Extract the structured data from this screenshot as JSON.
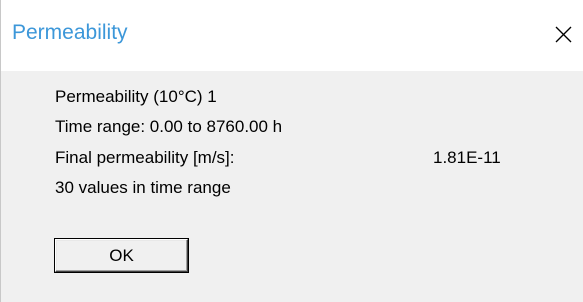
{
  "window": {
    "title": "Permeability",
    "close_icon": "close-icon"
  },
  "info": {
    "line1": "Permeability (10°C) 1",
    "line2": "Time range: 0.00 to 8760.00 h",
    "final_label": "Final permeability [m/s]:",
    "final_value": "1.81E-11",
    "line4": "30 values in time range"
  },
  "buttons": {
    "ok_label": "OK"
  }
}
